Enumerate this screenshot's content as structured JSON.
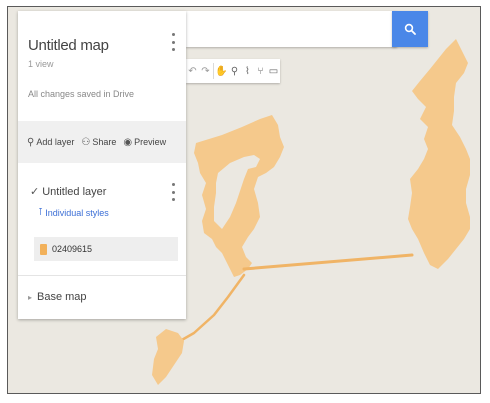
{
  "search": {
    "placeholder": "",
    "value": ""
  },
  "panel": {
    "map_title": "Untitled map",
    "views": "1 view",
    "saved_status": "All changes saved in Drive",
    "actions": [
      {
        "icon": "add-layer-icon",
        "label": "Add layer"
      },
      {
        "icon": "share-icon",
        "label": "Share"
      },
      {
        "icon": "preview-icon",
        "label": "Preview"
      }
    ],
    "layer": {
      "name": "Untitled layer",
      "checked": true,
      "styles_link": "Individual styles",
      "feature_label": "02409615",
      "feature_color": "#f2b15b"
    },
    "base_map_label": "Base map"
  },
  "toolbar": {
    "tools": [
      "undo-icon",
      "redo-icon",
      "hand-icon",
      "marker-icon",
      "draw-line-icon",
      "route-icon",
      "ruler-icon"
    ]
  },
  "map": {
    "background_color": "#ebe8e1",
    "feature_fill": "#f5c98c",
    "accent_color": "#4a87e8"
  }
}
